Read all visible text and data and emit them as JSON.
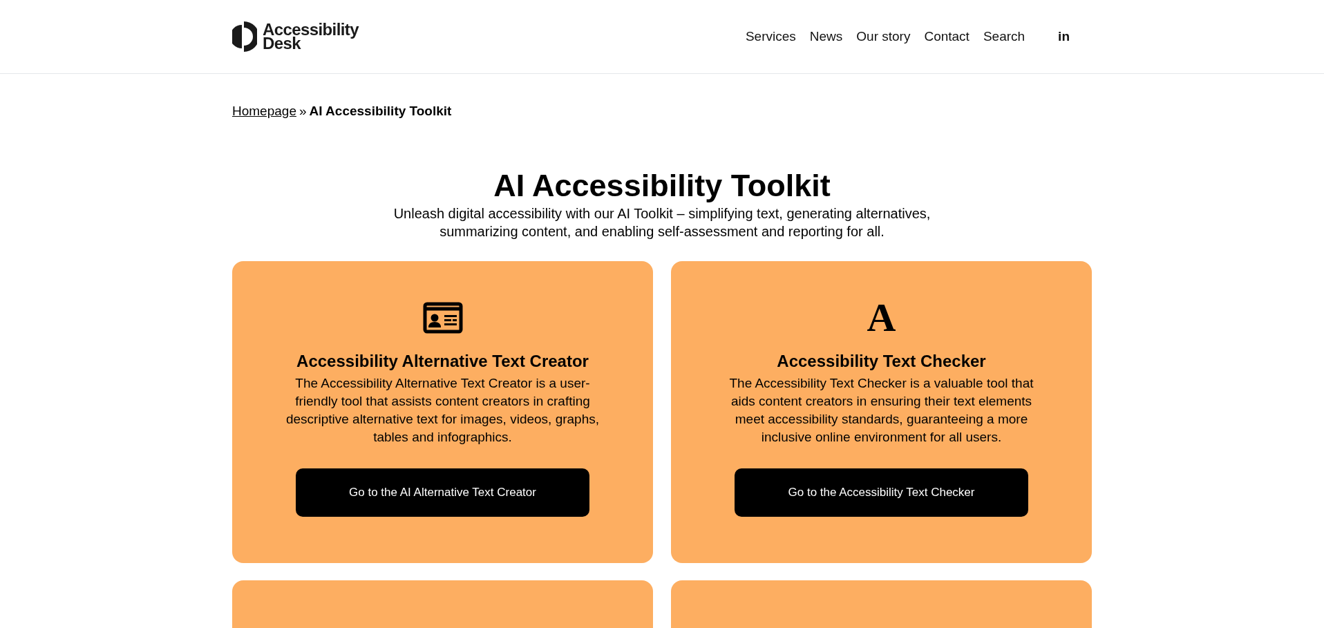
{
  "logo": {
    "line_1": "Accessibility",
    "line_2": "Desk"
  },
  "nav": {
    "items": [
      "Services",
      "News",
      "Our story",
      "Contact",
      "Search"
    ],
    "social": "in"
  },
  "breadcrumb": {
    "link": "Homepage",
    "separator": "»",
    "current": "AI Accessibility Toolkit"
  },
  "title": "AI Accessibility Toolkit",
  "subtitle": "Unleash digital accessibility with our AI Toolkit – simplifying text, generating alternatives, summarizing content, and enabling self-assessment and reporting for all.",
  "cards": [
    {
      "kind": "tool",
      "icon": {
        "kind": "id-card"
      },
      "heading": "Accessibility Alternative Text Creator",
      "text": "The Accessibility Alternative Text Creator is a user-friendly tool that assists content creators in crafting descriptive alternative text for images, videos, graphs, tables and infographics.",
      "button": "Go to the AI Alternative Text Creator"
    },
    {
      "kind": "tool",
      "icon": {
        "kind": "glyph",
        "glyph": "A"
      },
      "heading": "Accessibility Text Checker",
      "text": "The Accessibility Text Checker is a valuable tool that aids content creators in ensuring their text elements meet accessibility standards, guaranteeing a more inclusive online environment for all users.",
      "button": "Go to the Accessibility Text Checker"
    },
    {
      "kind": "empty"
    },
    {
      "kind": "empty"
    }
  ]
}
